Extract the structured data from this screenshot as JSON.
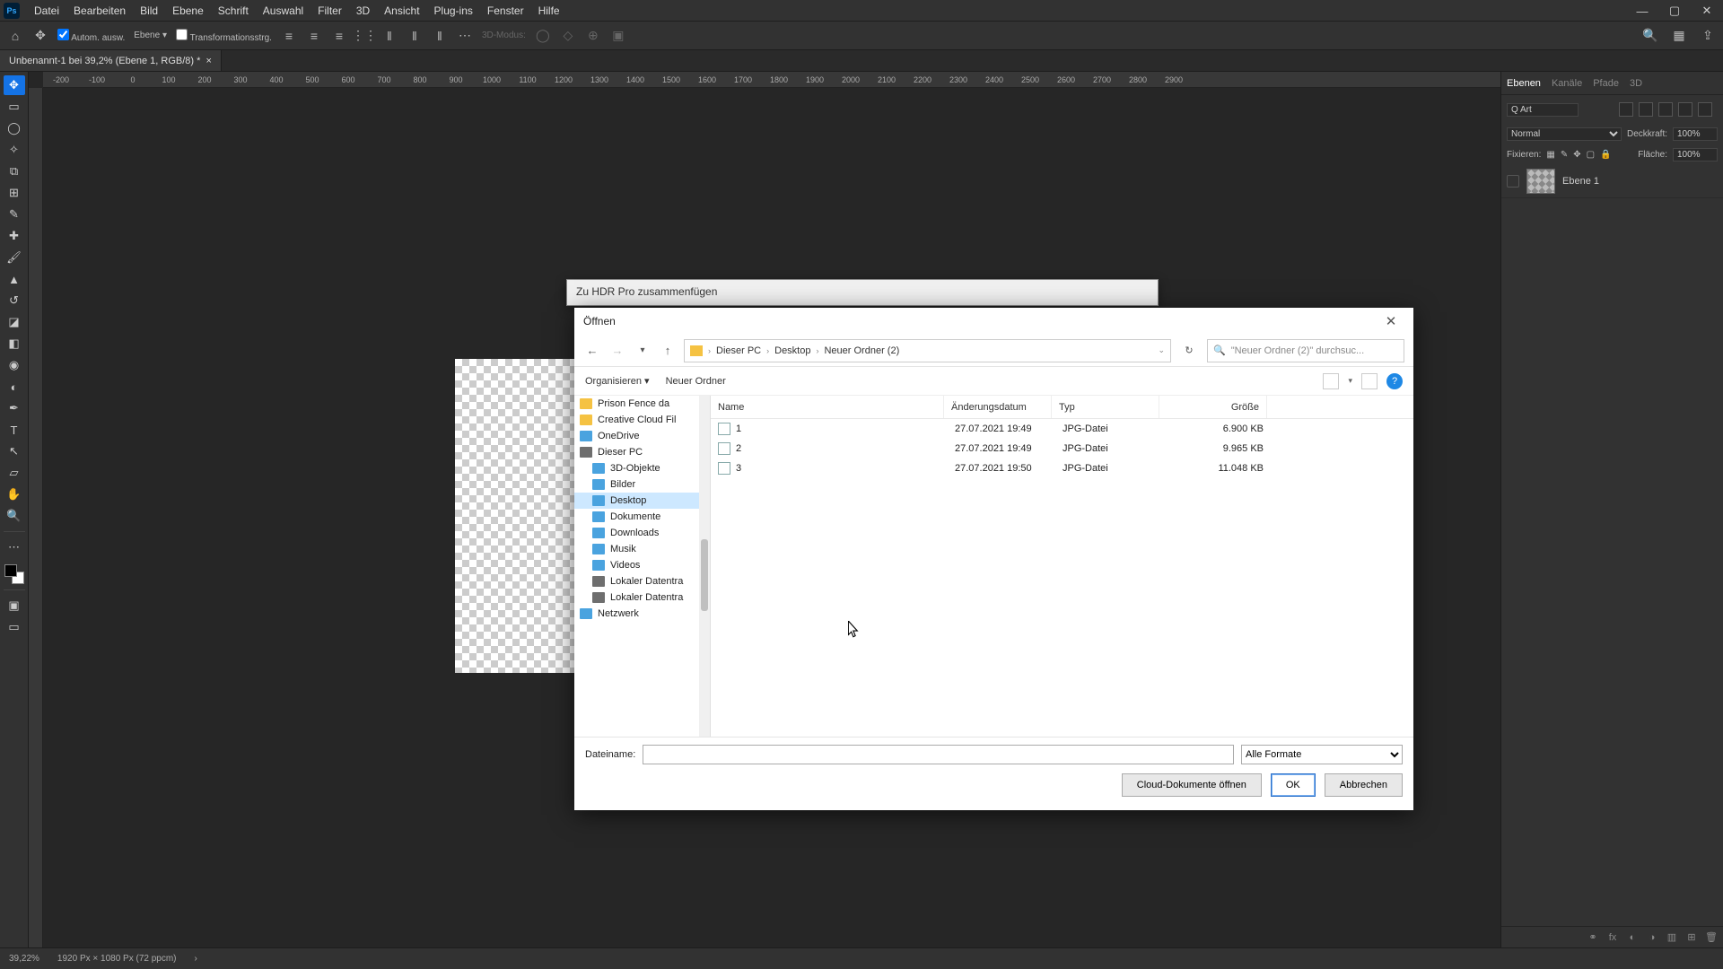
{
  "menubar": [
    "Datei",
    "Bearbeiten",
    "Bild",
    "Ebene",
    "Schrift",
    "Auswahl",
    "Filter",
    "3D",
    "Ansicht",
    "Plug-ins",
    "Fenster",
    "Hilfe"
  ],
  "optbar": {
    "auto_select": "Autom. ausw.",
    "layer": "Ebene",
    "transform": "Transformationsstrg.",
    "mode3d": "3D-Modus:"
  },
  "doc_tab": "Unbenannt-1 bei 39,2% (Ebene 1, RGB/8) *",
  "ruler_marks": [
    "-200",
    "-100",
    "0",
    "100",
    "200",
    "300",
    "400",
    "500",
    "600",
    "700",
    "800",
    "900",
    "1000",
    "1100",
    "1200",
    "1300",
    "1400",
    "1500",
    "1600",
    "1700",
    "1800",
    "1900",
    "2000",
    "2100",
    "2200",
    "2300",
    "2400",
    "2500",
    "2600",
    "2700",
    "2800",
    "2900"
  ],
  "hdr_dialog": {
    "title": "Zu HDR Pro zusammenfügen"
  },
  "open_dialog": {
    "title": "Öffnen",
    "breadcrumb": [
      "Dieser PC",
      "Desktop",
      "Neuer Ordner (2)"
    ],
    "search_placeholder": "\"Neuer Ordner (2)\" durchsuc...",
    "organize": "Organisieren",
    "new_folder": "Neuer Ordner",
    "tree": [
      {
        "label": "Prison Fence da",
        "icon": "folder",
        "indent": false
      },
      {
        "label": "Creative Cloud Fil",
        "icon": "folder",
        "indent": false
      },
      {
        "label": "OneDrive",
        "icon": "blue",
        "indent": false
      },
      {
        "label": "Dieser PC",
        "icon": "pc",
        "indent": false
      },
      {
        "label": "3D-Objekte",
        "icon": "blue",
        "indent": true
      },
      {
        "label": "Bilder",
        "icon": "blue",
        "indent": true
      },
      {
        "label": "Desktop",
        "icon": "blue",
        "indent": true,
        "selected": true
      },
      {
        "label": "Dokumente",
        "icon": "blue",
        "indent": true
      },
      {
        "label": "Downloads",
        "icon": "blue",
        "indent": true
      },
      {
        "label": "Musik",
        "icon": "blue",
        "indent": true
      },
      {
        "label": "Videos",
        "icon": "blue",
        "indent": true
      },
      {
        "label": "Lokaler Datentra",
        "icon": "pc",
        "indent": true
      },
      {
        "label": "Lokaler Datentra",
        "icon": "pc",
        "indent": true
      },
      {
        "label": "Netzwerk",
        "icon": "blue",
        "indent": false
      }
    ],
    "columns": {
      "name": "Name",
      "date": "Änderungsdatum",
      "type": "Typ",
      "size": "Größe"
    },
    "files": [
      {
        "name": "1",
        "date": "27.07.2021 19:49",
        "type": "JPG-Datei",
        "size": "6.900 KB"
      },
      {
        "name": "2",
        "date": "27.07.2021 19:49",
        "type": "JPG-Datei",
        "size": "9.965 KB"
      },
      {
        "name": "3",
        "date": "27.07.2021 19:50",
        "type": "JPG-Datei",
        "size": "11.048 KB"
      }
    ],
    "filename_label": "Dateiname:",
    "filetype": "Alle Formate",
    "cloud_btn": "Cloud-Dokumente öffnen",
    "ok": "OK",
    "cancel": "Abbrechen"
  },
  "layers_panel": {
    "tabs": [
      "Ebenen",
      "Kanäle",
      "Pfade",
      "3D"
    ],
    "filter": "Q Art",
    "blend": "Normal",
    "opacity_label": "Deckkraft:",
    "opacity": "100%",
    "lock_label": "Fixieren:",
    "fill_label": "Fläche:",
    "fill": "100%",
    "layer_name": "Ebene 1"
  },
  "status": {
    "zoom": "39,22%",
    "docinfo": "1920 Px × 1080 Px (72 ppcm)"
  }
}
